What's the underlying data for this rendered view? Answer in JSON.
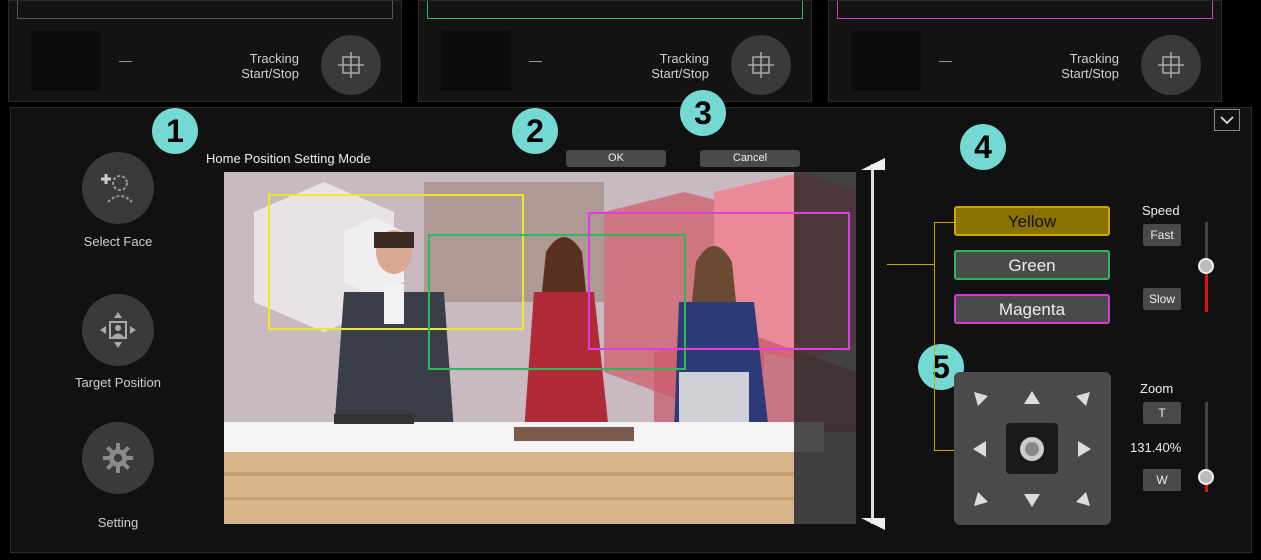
{
  "top_panels": [
    {
      "name_text": "—",
      "tracking_label": "Tracking\nStart/Stop",
      "accent": "#c9b400"
    },
    {
      "name_text": "—",
      "tracking_label": "Tracking\nStart/Stop",
      "accent": "#2db85a"
    },
    {
      "name_text": "—",
      "tracking_label": "Tracking\nStart/Stop",
      "accent": "#d23cd0"
    }
  ],
  "callouts": [
    "1",
    "2",
    "3",
    "4",
    "5"
  ],
  "sidebar": {
    "select_face": "Select Face",
    "target_position": "Target Position",
    "setting": "Setting"
  },
  "mode_title": "Home Position Setting Mode",
  "buttons": {
    "ok": "OK",
    "cancel": "Cancel"
  },
  "colors": {
    "yellow_label": "Yellow",
    "green_label": "Green",
    "magenta_label": "Magenta",
    "yellow": "#f2e62a",
    "green": "#2db85a",
    "magenta": "#e23ce0"
  },
  "speed": {
    "label": "Speed",
    "fast": "Fast",
    "slow": "Slow"
  },
  "zoom": {
    "label": "Zoom",
    "tele": "T",
    "wide": "W",
    "value": "131.40%"
  }
}
